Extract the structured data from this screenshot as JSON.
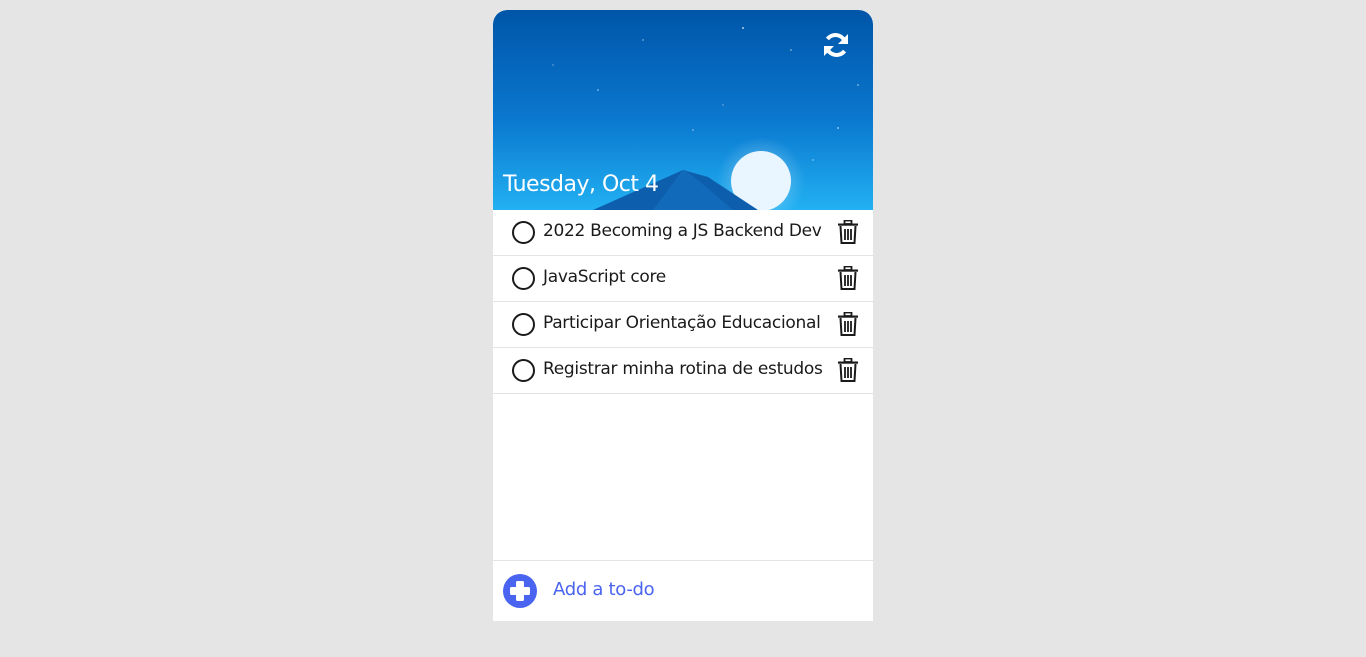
{
  "header": {
    "date": "Tuesday, Oct 4",
    "refresh_icon": "refresh-icon",
    "gradient_top": "#0055a8",
    "gradient_bottom": "#1aa6ee"
  },
  "todos": [
    {
      "text": "2022 Becoming a JS Backend Dev",
      "done": false
    },
    {
      "text": "JavaScript core",
      "done": false
    },
    {
      "text": "Participar Orientação Educacional",
      "done": false
    },
    {
      "text": "Registrar minha rotina de estudos",
      "done": false
    }
  ],
  "footer": {
    "add_label": "Add a to-do",
    "add_icon": "plus-circle-icon",
    "accent": "#4a64f0"
  }
}
